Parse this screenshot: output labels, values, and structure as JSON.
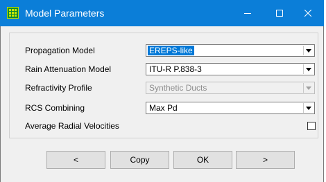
{
  "window": {
    "title": "Model Parameters",
    "app_icon": "grid-app-icon",
    "controls": [
      "minimize-icon",
      "maximize-icon",
      "close-icon"
    ]
  },
  "form": {
    "rows": [
      {
        "label": "Propagation Model",
        "value": "EREPS-like",
        "selected": true,
        "enabled": true
      },
      {
        "label": "Rain Attenuation Model",
        "value": "ITU-R P.838-3",
        "enabled": true
      },
      {
        "label": "Refractivity Profile",
        "value": "Synthetic Ducts",
        "enabled": false
      },
      {
        "label": "RCS Combining",
        "value": "Max Pd",
        "enabled": true
      }
    ],
    "checkbox": {
      "label": "Average Radial Velocities",
      "checked": false
    }
  },
  "buttons": {
    "prev": "<",
    "copy": "Copy",
    "ok": "OK",
    "next": ">"
  },
  "colors": {
    "titlebar": "#0b7ed8",
    "selection": "#0078d7",
    "dialog_bg": "#f0f0f0"
  }
}
